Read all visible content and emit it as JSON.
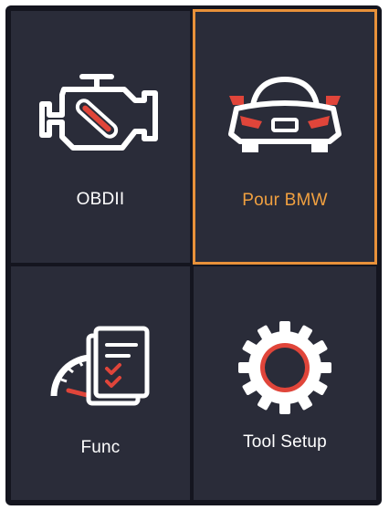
{
  "menu": {
    "tiles": [
      {
        "label": "OBDII",
        "icon": "engine-check-icon",
        "selected": false
      },
      {
        "label": "Pour BMW",
        "icon": "car-front-icon",
        "selected": true
      },
      {
        "label": "Func",
        "icon": "gauge-clipboard-icon",
        "selected": false
      },
      {
        "label": "Tool Setup",
        "icon": "gear-icon",
        "selected": false
      }
    ]
  },
  "colors": {
    "screen_bg": "#14151f",
    "tile_bg": "#2a2c39",
    "selection_border": "#e8913a",
    "selected_label": "#f0a040",
    "icon_white": "#ffffff",
    "icon_red": "#e0453a"
  }
}
